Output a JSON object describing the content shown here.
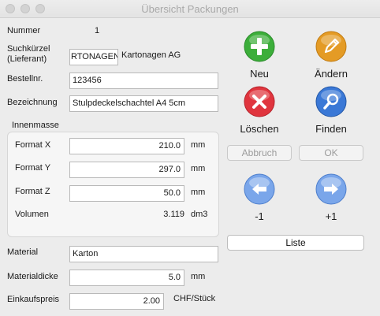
{
  "window": {
    "title": "Übersicht Packungen"
  },
  "form": {
    "nummer_label": "Nummer",
    "nummer_value": "1",
    "suchkuerzel_label_1": "Suchkürzel",
    "suchkuerzel_label_2": "(Lieferant)",
    "suchkuerzel_value": "RTONAGEN",
    "lieferant_name": "Kartonagen AG",
    "bestellnr_label": "Bestellnr.",
    "bestellnr_value": "123456",
    "bezeichnung_label": "Bezeichnung",
    "bezeichnung_value": "Stulpdeckelschachtel A4 5cm",
    "material_label": "Material",
    "material_value": "Karton",
    "materialdicke_label": "Materialdicke",
    "materialdicke_value": "5.0",
    "materialdicke_unit": "mm",
    "einkaufspreis_label": "Einkaufspreis",
    "einkaufspreis_value": "2.00",
    "einkaufspreis_unit": "CHF/Stück"
  },
  "innenmasse": {
    "label": "Innenmasse",
    "format_x_label": "Format X",
    "format_x_value": "210.0",
    "format_y_label": "Format Y",
    "format_y_value": "297.0",
    "format_z_label": "Format Z",
    "format_z_value": "50.0",
    "mm_unit": "mm",
    "volumen_label": "Volumen",
    "volumen_value": "3.119",
    "volumen_unit": "dm3"
  },
  "actions": {
    "neu": "Neu",
    "aendern": "Ändern",
    "loeschen": "Löschen",
    "finden": "Finden",
    "abbruch": "Abbruch",
    "ok": "OK",
    "prev": "-1",
    "next": "+1",
    "liste": "Liste"
  },
  "colors": {
    "green": "#3cae3a",
    "orange": "#e49b25",
    "red": "#e0353e",
    "blue": "#3a78d6"
  }
}
